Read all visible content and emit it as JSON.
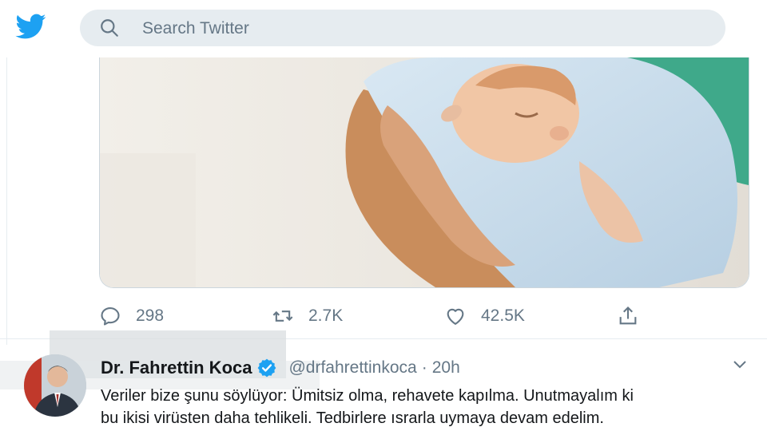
{
  "header": {
    "logo_icon": "twitter-bird-icon",
    "search": {
      "placeholder": "Search Twitter",
      "icon": "search-icon"
    },
    "brand_color": "#1da1f2"
  },
  "media": {
    "alt": "newborn-baby-photo"
  },
  "actions": {
    "reply": {
      "icon": "reply-icon",
      "count": "298"
    },
    "retweet": {
      "icon": "retweet-icon",
      "count": "2.7K"
    },
    "like": {
      "icon": "heart-icon",
      "count": "42.5K"
    },
    "share": {
      "icon": "share-icon"
    }
  },
  "tweet": {
    "display_name": "Dr. Fahrettin Koca",
    "verified": true,
    "handle": "@drfahrettinkoca",
    "separator": "·",
    "time": "20h",
    "text_line1": "Veriler bize şunu söylüyor: Ümitsiz olma, rehavete kapılma. Unutmayalım ki",
    "text_line2": "bu ikisi virüsten daha tehlikeli. Tedbirlere ısrarla uymaya devam edelim."
  }
}
